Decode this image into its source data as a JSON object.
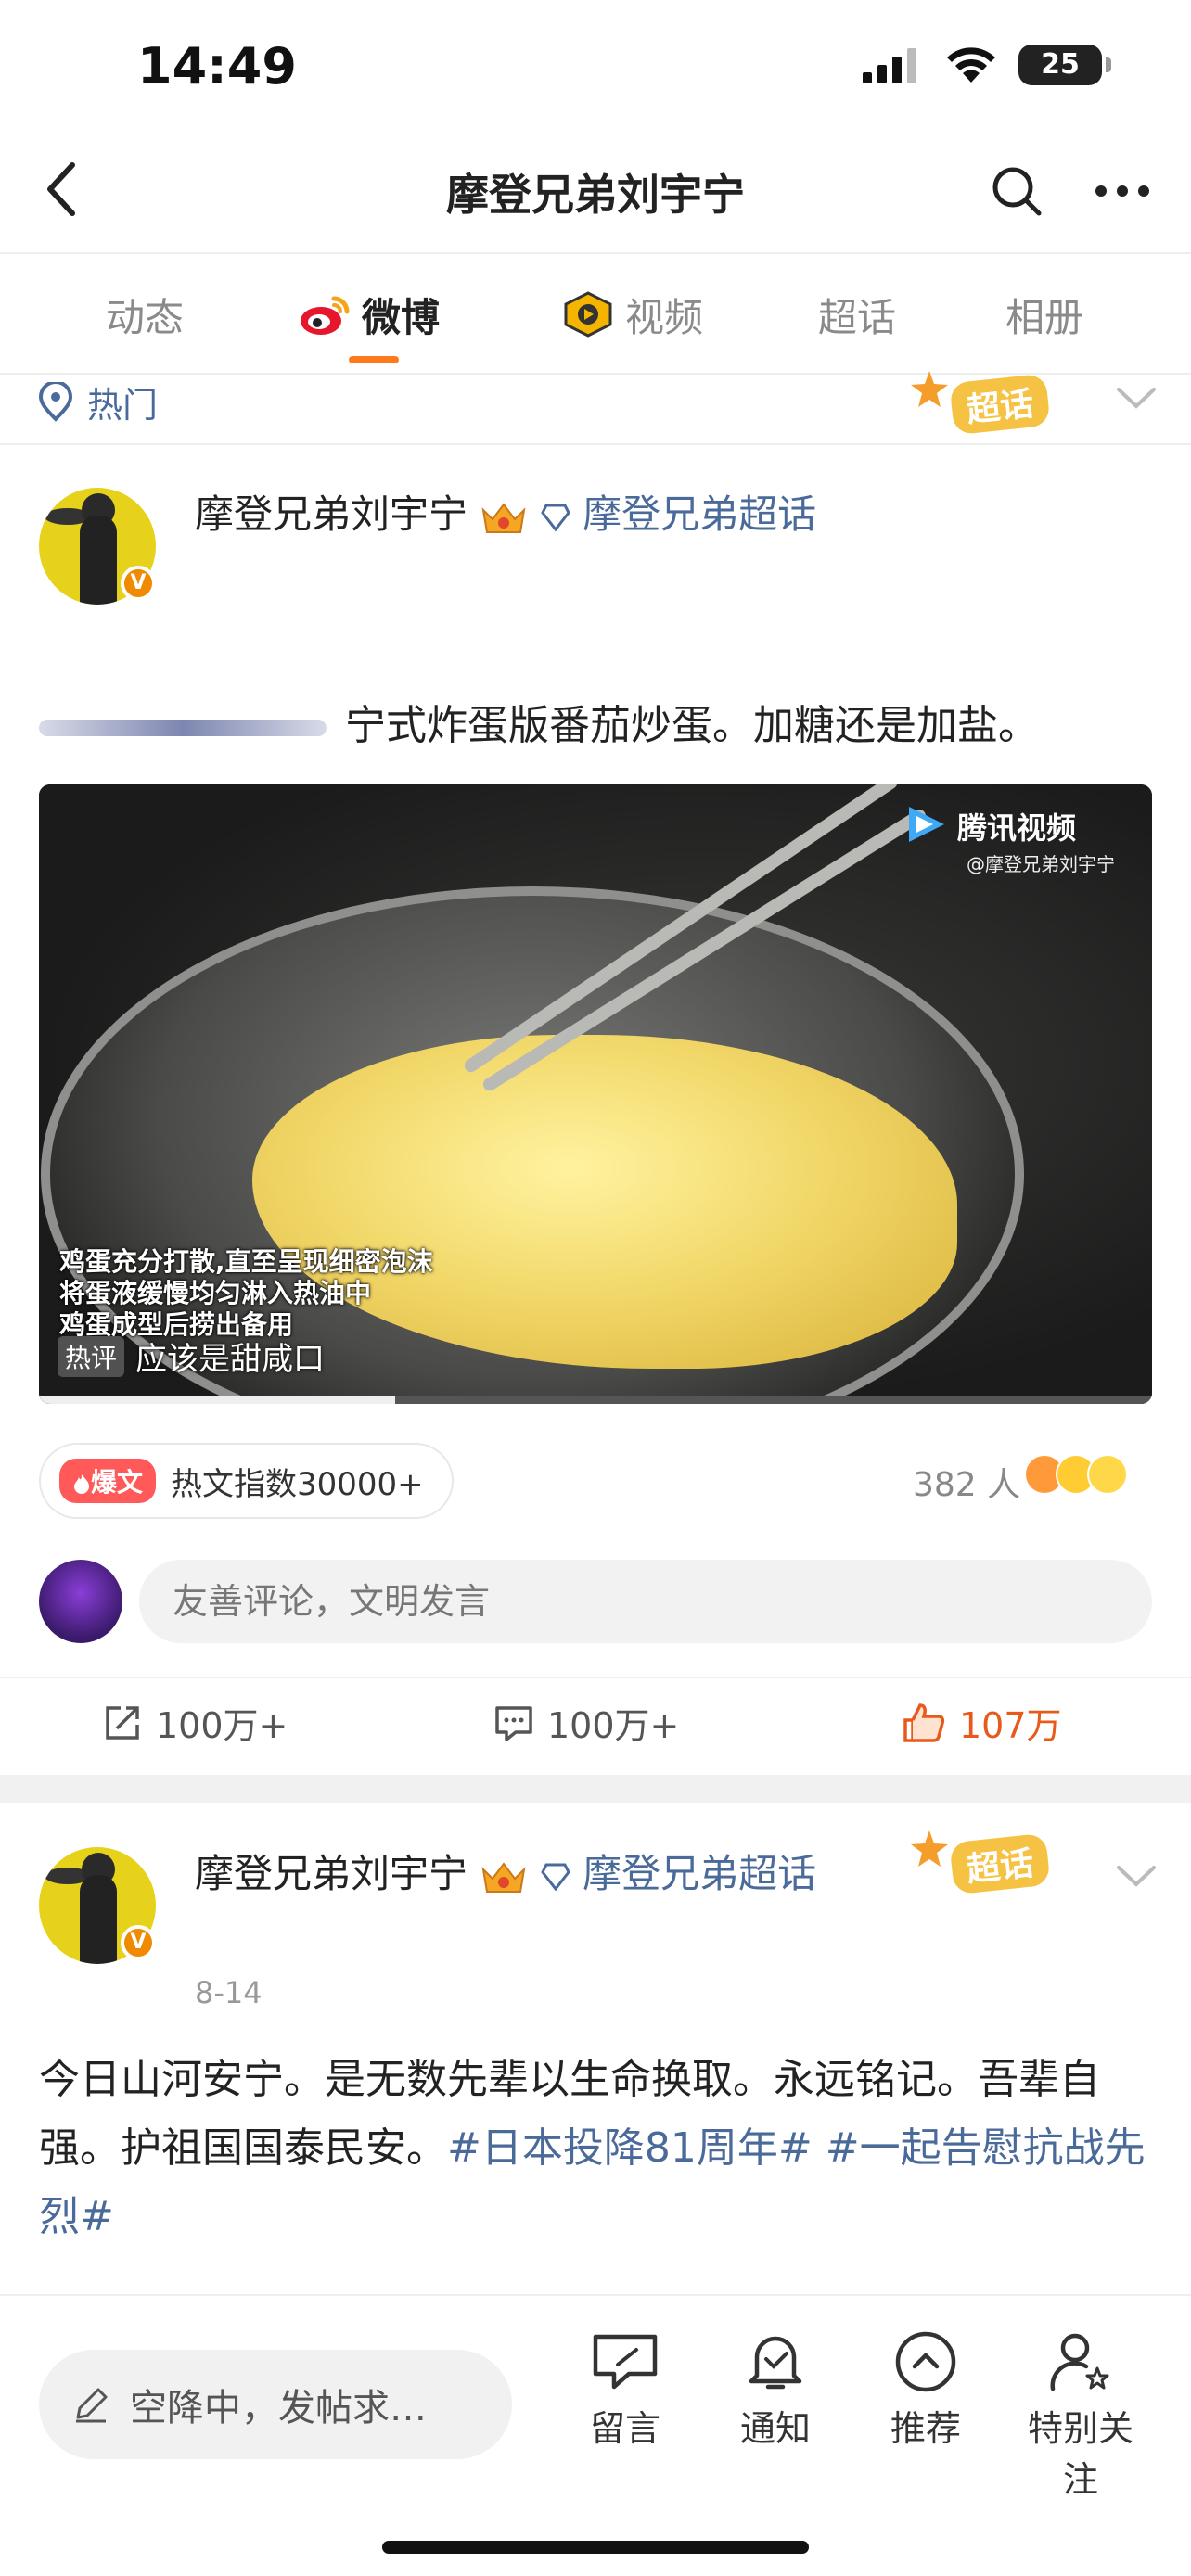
{
  "status_bar": {
    "time": "14:49",
    "battery": "25"
  },
  "nav": {
    "title": "摩登兄弟刘宇宁"
  },
  "tabs": [
    {
      "label": "动态"
    },
    {
      "label": "微博"
    },
    {
      "label": "视频"
    },
    {
      "label": "超话"
    },
    {
      "label": "相册"
    }
  ],
  "hot_section": {
    "label": "热门",
    "badge": "超话"
  },
  "post1": {
    "author": "摩登兄弟刘宇宁",
    "supertopic_link": "摩登兄弟超话",
    "text": "宁式炸蛋版番茄炒蛋。加糖还是加盐。",
    "video": {
      "logo": "腾讯视频",
      "watermark": "@摩登兄弟刘宇宁",
      "caption_lines": [
        "鸡蛋充分打散,直至呈现细密泡沫",
        "将蛋液缓慢均匀淋入热油中",
        "鸡蛋成型后捞出备用"
      ],
      "hot_comment_tag": "热评",
      "hot_comment": "应该是甜咸口",
      "progress": 0.32
    },
    "hot_index_tag": "爆文",
    "hot_index": "热文指数30000+",
    "reactions_count": "382 人",
    "comment_placeholder": "友善评论，文明发言",
    "actions": {
      "repost": "100万+",
      "comment": "100万+",
      "like": "107万"
    },
    "colors": {
      "like_active": "#e85a1c",
      "link": "#4a6a9a",
      "accent": "#ff7a1a"
    }
  },
  "post2": {
    "author": "摩登兄弟刘宇宁",
    "supertopic_link": "摩登兄弟超话",
    "badge": "超话",
    "date": "8-14",
    "text_plain": "今日山河安宁。是无数先辈以生命换取。永远铭记。吾辈自强。护祖国国泰民安。",
    "hashtag1": "#日本投降81周年#",
    "hashtag2": "#一起告慰抗战先烈#"
  },
  "bottom_bar": {
    "compose_placeholder": "空降中，发帖求…",
    "items": [
      {
        "label": "留言",
        "icon": "message-icon"
      },
      {
        "label": "通知",
        "icon": "bell-icon"
      },
      {
        "label": "推荐",
        "icon": "up-circle-icon"
      },
      {
        "label": "特别关注",
        "icon": "user-star-icon"
      }
    ]
  }
}
